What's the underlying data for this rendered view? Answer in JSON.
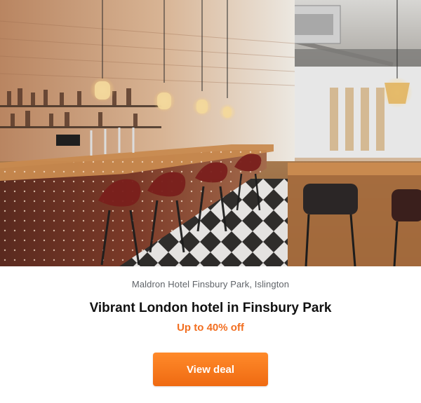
{
  "hero_image": {
    "subject": "hotel bar interior with pendant lights and bar stools"
  },
  "card": {
    "property": "Maldron Hotel Finsbury Park, Islington",
    "headline": "Vibrant London hotel in Finsbury Park",
    "discount": "Up to 40% off",
    "cta_label": "View deal"
  },
  "colors": {
    "accent": "#f26f21",
    "button": "#ef6a12",
    "headline": "#111111",
    "meta": "#5f6368"
  }
}
